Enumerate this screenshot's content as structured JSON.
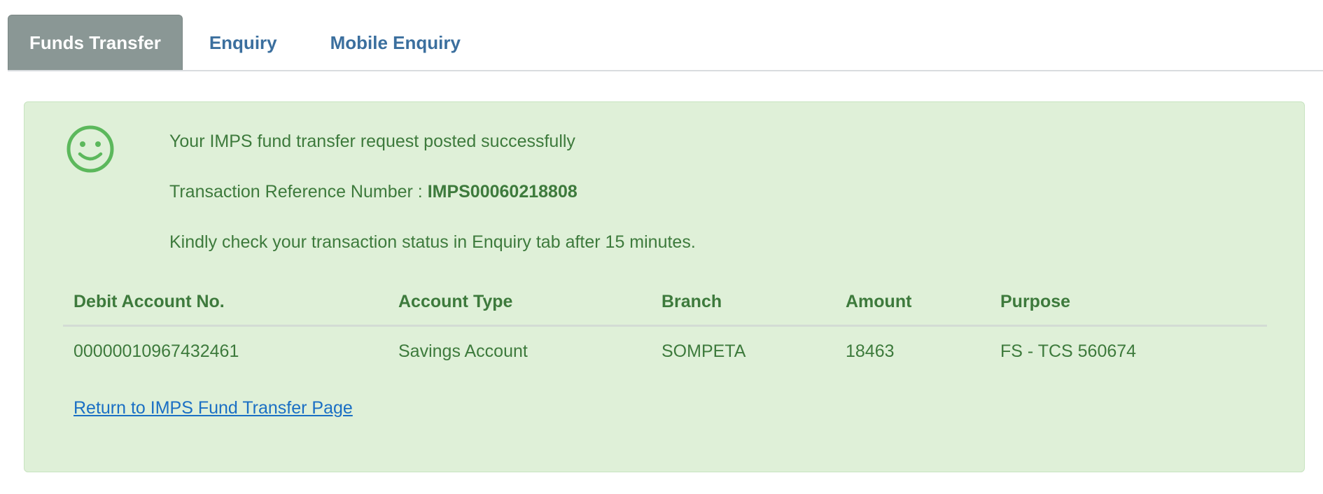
{
  "tabs": [
    {
      "label": "Funds Transfer",
      "active": true
    },
    {
      "label": "Enquiry",
      "active": false
    },
    {
      "label": "Mobile Enquiry",
      "active": false
    }
  ],
  "alert": {
    "icon": "smiley-icon",
    "message": "Your IMPS fund transfer request posted successfully",
    "ref_label": "Transaction Reference Number : ",
    "ref_value": "IMPS00060218808",
    "note": "Kindly check your transaction status in Enquiry tab after 15 minutes."
  },
  "table": {
    "headers": [
      "Debit Account No.",
      "Account Type",
      "Branch",
      "Amount",
      "Purpose"
    ],
    "rows": [
      [
        "00000010967432461",
        "Savings Account",
        "SOMPETA",
        "18463",
        "FS - TCS 560674"
      ]
    ]
  },
  "return_link": "Return to IMPS Fund Transfer Page",
  "colors": {
    "success_bg": "#dff0d8",
    "success_text": "#3d7a3c",
    "tab_active_bg": "#8a9795",
    "tab_text": "#3b6f9e",
    "link": "#1a6fc4"
  }
}
